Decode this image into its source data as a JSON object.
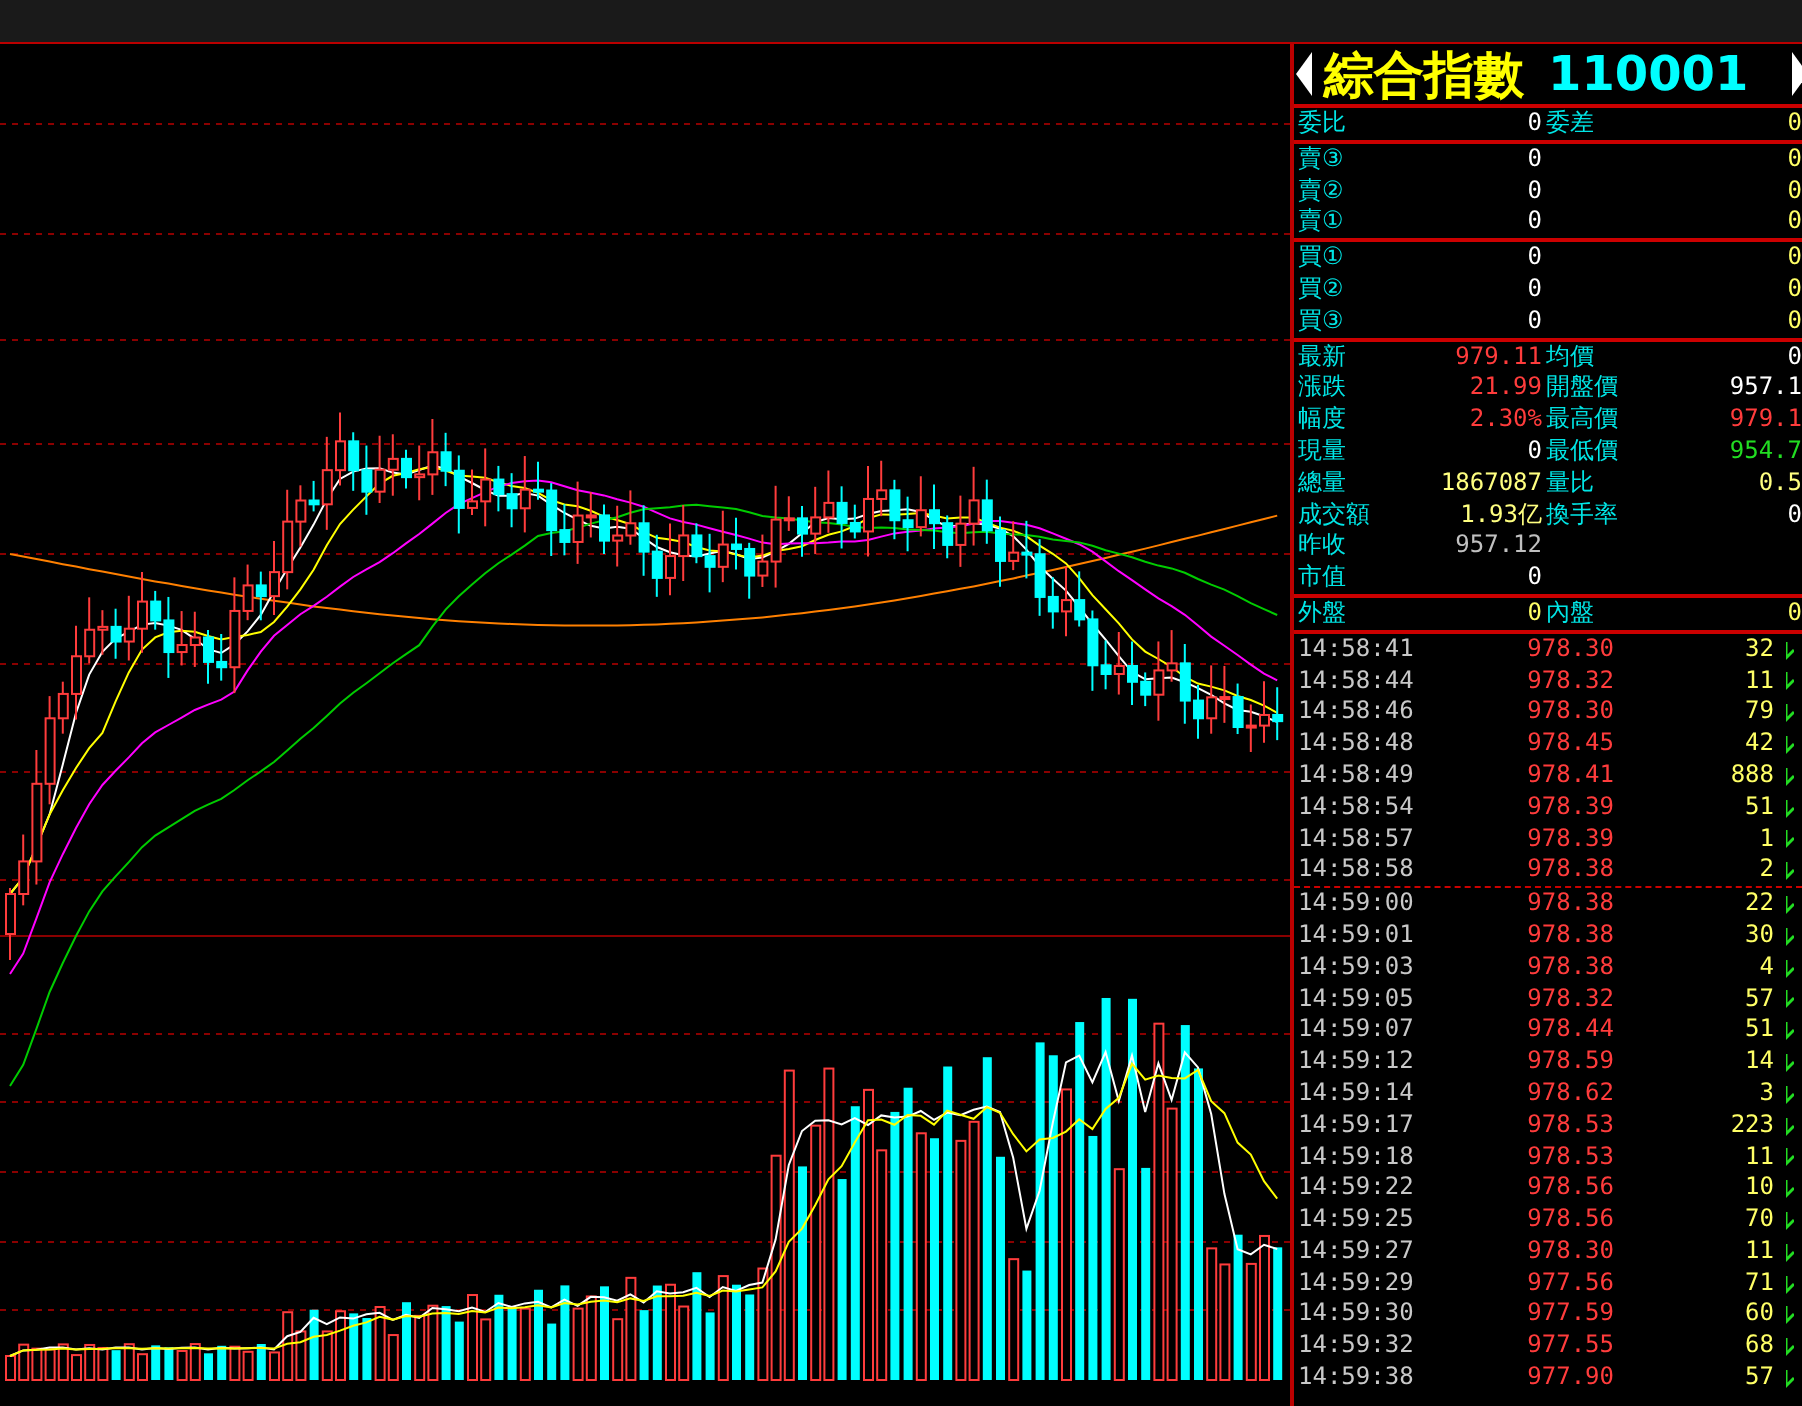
{
  "quote_header": {
    "name": "綜合指數",
    "code": "110001"
  },
  "ratio_row": [
    {
      "label": "委比",
      "value": "0"
    },
    {
      "label": "委差",
      "value": "0"
    }
  ],
  "sell_orders": [
    {
      "label": "賣③",
      "price": "0",
      "volume": "0"
    },
    {
      "label": "賣②",
      "price": "0",
      "volume": "0"
    },
    {
      "label": "賣①",
      "price": "0",
      "volume": "0"
    }
  ],
  "buy_orders": [
    {
      "label": "買①",
      "price": "0",
      "volume": "0"
    },
    {
      "label": "買②",
      "price": "0",
      "volume": "0"
    },
    {
      "label": "買③",
      "price": "0",
      "volume": "0"
    }
  ],
  "stats": [
    [
      {
        "label": "最新",
        "value": "979.11",
        "color": "#ff3c3c"
      },
      {
        "label": "均價",
        "value": "0",
        "color": "#ffffff"
      }
    ],
    [
      {
        "label": "漲跌",
        "value": "21.99",
        "color": "#ff3c3c"
      },
      {
        "label": "開盤價",
        "value": "957.1",
        "color": "#ffffff"
      }
    ],
    [
      {
        "label": "幅度",
        "value": "2.30%",
        "color": "#ff3c3c"
      },
      {
        "label": "最高價",
        "value": "979.1",
        "color": "#ff3c3c"
      }
    ],
    [
      {
        "label": "現量",
        "value": "0",
        "color": "#ffffff"
      },
      {
        "label": "最低價",
        "value": "954.7",
        "color": "#22dd22"
      }
    ],
    [
      {
        "label": "總量",
        "value": "1867087",
        "color": "#ffff80"
      },
      {
        "label": "量比",
        "value": "0.5",
        "color": "#ffff80"
      }
    ],
    [
      {
        "label": "成交額",
        "value": "1.93亿",
        "color": "#ffff80"
      },
      {
        "label": "換手率",
        "value": "0",
        "color": "#ffffff"
      }
    ],
    [
      {
        "label": "昨收",
        "value": "957.12",
        "color": "#c0c0c0"
      }
    ],
    [
      {
        "label": "市值",
        "value": "0",
        "color": "#ffffff"
      }
    ]
  ],
  "outer_inner": [
    {
      "label": "外盤",
      "value": "0"
    },
    {
      "label": "內盤",
      "value": "0"
    }
  ],
  "trade_groups": [
    [
      {
        "time": "14:58:41",
        "price": "978.30",
        "volume": "32"
      },
      {
        "time": "14:58:44",
        "price": "978.32",
        "volume": "11"
      },
      {
        "time": "14:58:46",
        "price": "978.30",
        "volume": "79"
      },
      {
        "time": "14:58:48",
        "price": "978.45",
        "volume": "42"
      },
      {
        "time": "14:58:49",
        "price": "978.41",
        "volume": "888"
      },
      {
        "time": "14:58:54",
        "price": "978.39",
        "volume": "51"
      },
      {
        "time": "14:58:57",
        "price": "978.39",
        "volume": "1"
      },
      {
        "time": "14:58:58",
        "price": "978.38",
        "volume": "2"
      }
    ],
    [
      {
        "time": "14:59:00",
        "price": "978.38",
        "volume": "22"
      },
      {
        "time": "14:59:01",
        "price": "978.38",
        "volume": "30"
      },
      {
        "time": "14:59:03",
        "price": "978.38",
        "volume": "4"
      },
      {
        "time": "14:59:05",
        "price": "978.32",
        "volume": "57"
      },
      {
        "time": "14:59:07",
        "price": "978.44",
        "volume": "51"
      },
      {
        "time": "14:59:12",
        "price": "978.59",
        "volume": "14"
      },
      {
        "time": "14:59:14",
        "price": "978.62",
        "volume": "3"
      },
      {
        "time": "14:59:17",
        "price": "978.53",
        "volume": "223"
      },
      {
        "time": "14:59:18",
        "price": "978.53",
        "volume": "11"
      },
      {
        "time": "14:59:22",
        "price": "978.56",
        "volume": "10"
      },
      {
        "time": "14:59:25",
        "price": "978.56",
        "volume": "70"
      },
      {
        "time": "14:59:27",
        "price": "978.30",
        "volume": "11"
      },
      {
        "time": "14:59:29",
        "price": "977.56",
        "volume": "71"
      },
      {
        "time": "14:59:30",
        "price": "977.59",
        "volume": "60"
      },
      {
        "time": "14:59:32",
        "price": "977.55",
        "volume": "68"
      },
      {
        "time": "14:59:38",
        "price": "977.90",
        "volume": "57"
      }
    ]
  ]
}
